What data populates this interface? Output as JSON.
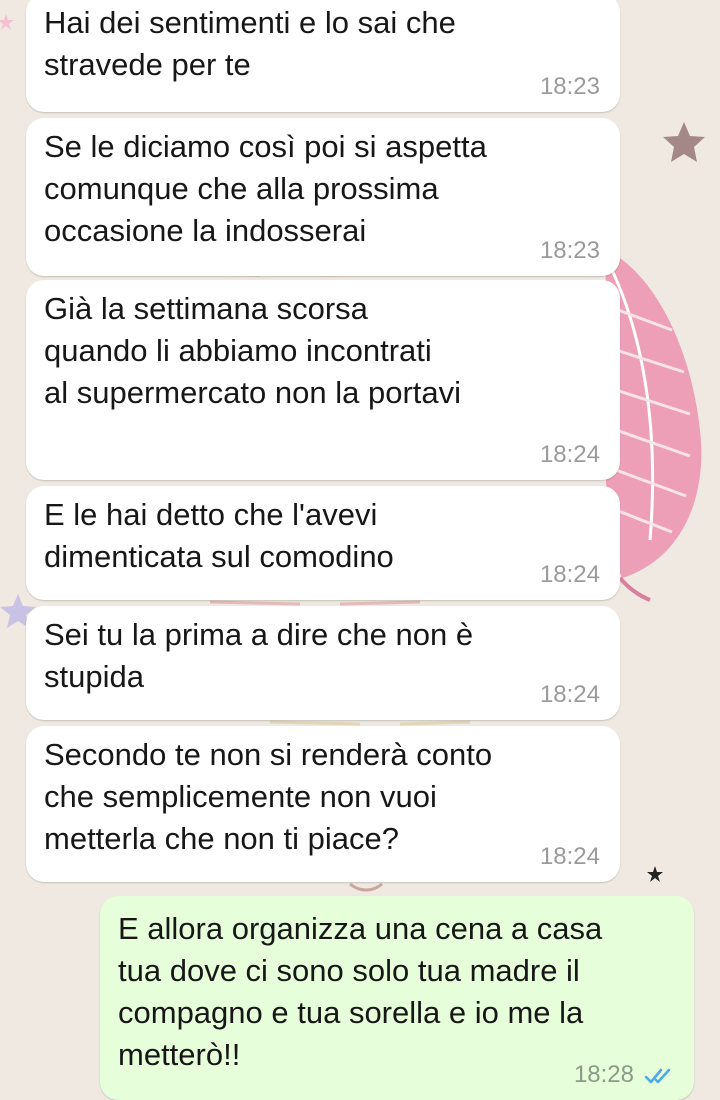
{
  "colors": {
    "background": "#efe9e2",
    "incoming_bubble": "#ffffff",
    "outgoing_bubble": "#e6ffda",
    "text": "#171717",
    "timestamp": "#9a9a9a",
    "read_ticks": "#4fa8e8"
  },
  "icons": {
    "read_receipt": "double-check-icon"
  },
  "messages": [
    {
      "direction": "incoming",
      "text": "Hai dei sentimenti e lo sai che\nstravede per te",
      "time": "18:23"
    },
    {
      "direction": "incoming",
      "text": "Se le diciamo così poi si aspetta\ncomunque che alla prossima\noccasione la indosserai",
      "time": "18:23"
    },
    {
      "direction": "incoming",
      "text": "Già la settimana scorsa\nquando li abbiamo incontrati\nal supermercato non la portavi",
      "time": "18:24"
    },
    {
      "direction": "incoming",
      "text": "E le hai detto che l'avevi\ndimenticata sul comodino",
      "time": "18:24"
    },
    {
      "direction": "incoming",
      "text": "Sei tu la prima a dire che non è\nstupida",
      "time": "18:24"
    },
    {
      "direction": "incoming",
      "text": "Secondo te non si renderà conto\nche semplicemente non vuoi\nmetterla che non ti piace?",
      "time": "18:24"
    },
    {
      "direction": "outgoing",
      "text": "E allora organizza una cena a casa\ntua dove ci sono solo tua madre il\ncompagno e tua sorella e io me la\nmetterò!!",
      "time": "18:28"
    }
  ]
}
